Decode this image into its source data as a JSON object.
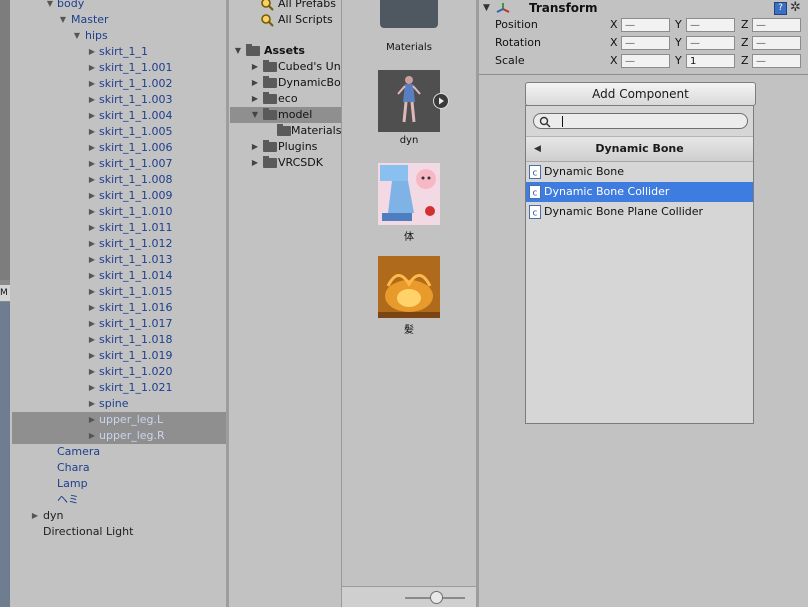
{
  "hierarchy": {
    "rows": [
      {
        "label": "body",
        "expanded": true
      },
      {
        "label": "Master",
        "expanded": true
      },
      {
        "label": "hips",
        "expanded": true
      },
      {
        "label": "skirt_1_1"
      },
      {
        "label": "skirt_1_1.001"
      },
      {
        "label": "skirt_1_1.002"
      },
      {
        "label": "skirt_1_1.003"
      },
      {
        "label": "skirt_1_1.004"
      },
      {
        "label": "skirt_1_1.005"
      },
      {
        "label": "skirt_1_1.006"
      },
      {
        "label": "skirt_1_1.007"
      },
      {
        "label": "skirt_1_1.008"
      },
      {
        "label": "skirt_1_1.009"
      },
      {
        "label": "skirt_1_1.010"
      },
      {
        "label": "skirt_1_1.011"
      },
      {
        "label": "skirt_1_1.012"
      },
      {
        "label": "skirt_1_1.013"
      },
      {
        "label": "skirt_1_1.014"
      },
      {
        "label": "skirt_1_1.015"
      },
      {
        "label": "skirt_1_1.016"
      },
      {
        "label": "skirt_1_1.017"
      },
      {
        "label": "skirt_1_1.018"
      },
      {
        "label": "skirt_1_1.019"
      },
      {
        "label": "skirt_1_1.020"
      },
      {
        "label": "skirt_1_1.021"
      },
      {
        "label": "spine"
      },
      {
        "label": "upper_leg.L",
        "selected": true
      },
      {
        "label": "upper_leg.R",
        "selected": true
      },
      {
        "label": "Camera"
      },
      {
        "label": "Chara"
      },
      {
        "label": "Lamp"
      },
      {
        "label": "ヘミ"
      },
      {
        "label": "dyn"
      },
      {
        "label": "Directional Light"
      }
    ]
  },
  "project": {
    "favorites": [
      {
        "label": "All Prefabs"
      },
      {
        "label": "All Scripts"
      }
    ],
    "assets_label": "Assets",
    "folders": [
      {
        "label": "Cubed's Unity Shaders"
      },
      {
        "label": "DynamicBone"
      },
      {
        "label": "eco"
      },
      {
        "label": "model",
        "selected": true
      },
      {
        "label": "Materials"
      },
      {
        "label": "Plugins"
      },
      {
        "label": "VRCSDK"
      }
    ],
    "grid": [
      {
        "label": "Materials",
        "icon": "folder-icon"
      },
      {
        "label": "dyn",
        "icon": "model-thumbnail"
      },
      {
        "label": "体",
        "icon": "texture-thumbnail"
      },
      {
        "label": "髪",
        "icon": "texture-thumbnail"
      }
    ]
  },
  "inspector": {
    "component_title": "Transform",
    "rows": [
      {
        "name": "Position",
        "x": "—",
        "y": "—",
        "z": "—"
      },
      {
        "name": "Rotation",
        "x": "—",
        "y": "—",
        "z": "—"
      },
      {
        "name": "Scale",
        "x": "—",
        "y": "1",
        "z": "—"
      }
    ],
    "axis": {
      "x": "X",
      "y": "Y",
      "z": "Z"
    },
    "add_component_label": "Add Component",
    "popup": {
      "search_value": "",
      "category_title": "Dynamic Bone",
      "back_glyph": "◀",
      "items": [
        {
          "label": "Dynamic Bone"
        },
        {
          "label": "Dynamic Bone Collider",
          "selected": true
        },
        {
          "label": "Dynamic Bone Plane Collider"
        }
      ]
    }
  },
  "colors": {
    "panel_bg": "#c2c2c2",
    "selection_blue": "#3e7ce0",
    "prefab_text_blue": "#1d3f8f",
    "row_selected_gray": "#8f8f8f"
  }
}
